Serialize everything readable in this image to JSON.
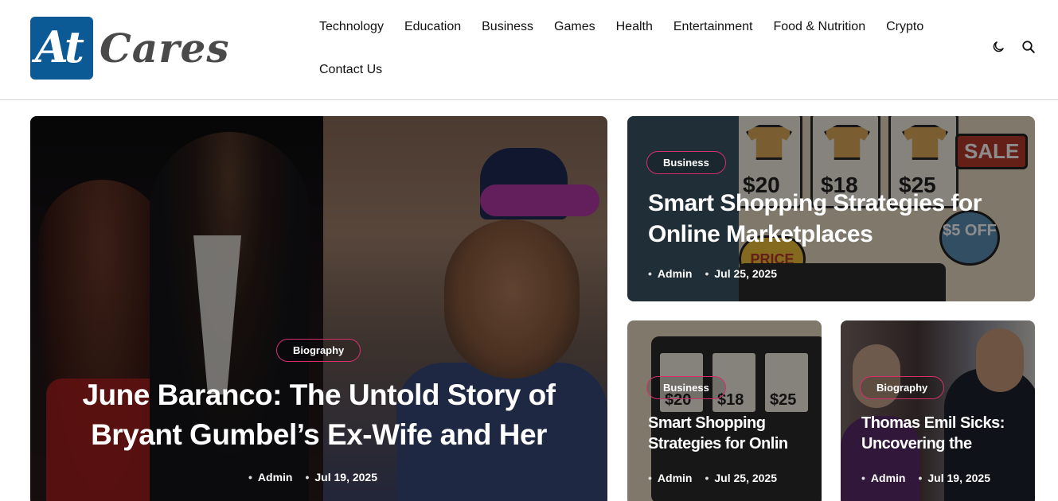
{
  "brand": {
    "logo_mark": "At",
    "logo_text": "Cares",
    "accent": "#0b5a96"
  },
  "nav": {
    "row1": [
      "Technology",
      "Education",
      "Business",
      "Games",
      "Health",
      "Entertainment",
      "Food & Nutrition",
      "Crypto"
    ],
    "row2": [
      "Contact Us"
    ]
  },
  "header_icons": [
    "moon-icon",
    "search-icon"
  ],
  "cards": {
    "main": {
      "category": "Biography",
      "title": "June Baranco: The Untold Story of Bryant Gumbel’s Ex-Wife and Her",
      "author": "Admin",
      "date": "Jul 19, 2025"
    },
    "top_right": {
      "category": "Business",
      "title": "Smart Shopping Strategies for Online Marketplaces",
      "author": "Admin",
      "date": "Jul 25, 2025",
      "prices": [
        "$20",
        "$18",
        "$25"
      ],
      "sale_label": "SALE",
      "off_label": "$5 OFF",
      "price_label": "PRICE"
    },
    "bottom_left": {
      "category": "Business",
      "title": "Smart Shopping Strategies for Onlin",
      "author": "Admin",
      "date": "Jul 25, 2025",
      "prices": [
        "$20",
        "$18",
        "$25"
      ]
    },
    "bottom_right": {
      "category": "Biography",
      "title": "Thomas Emil Sicks: Uncovering the",
      "author": "Admin",
      "date": "Jul 19, 2025"
    }
  },
  "colors": {
    "badge_border": "#d4306c"
  }
}
